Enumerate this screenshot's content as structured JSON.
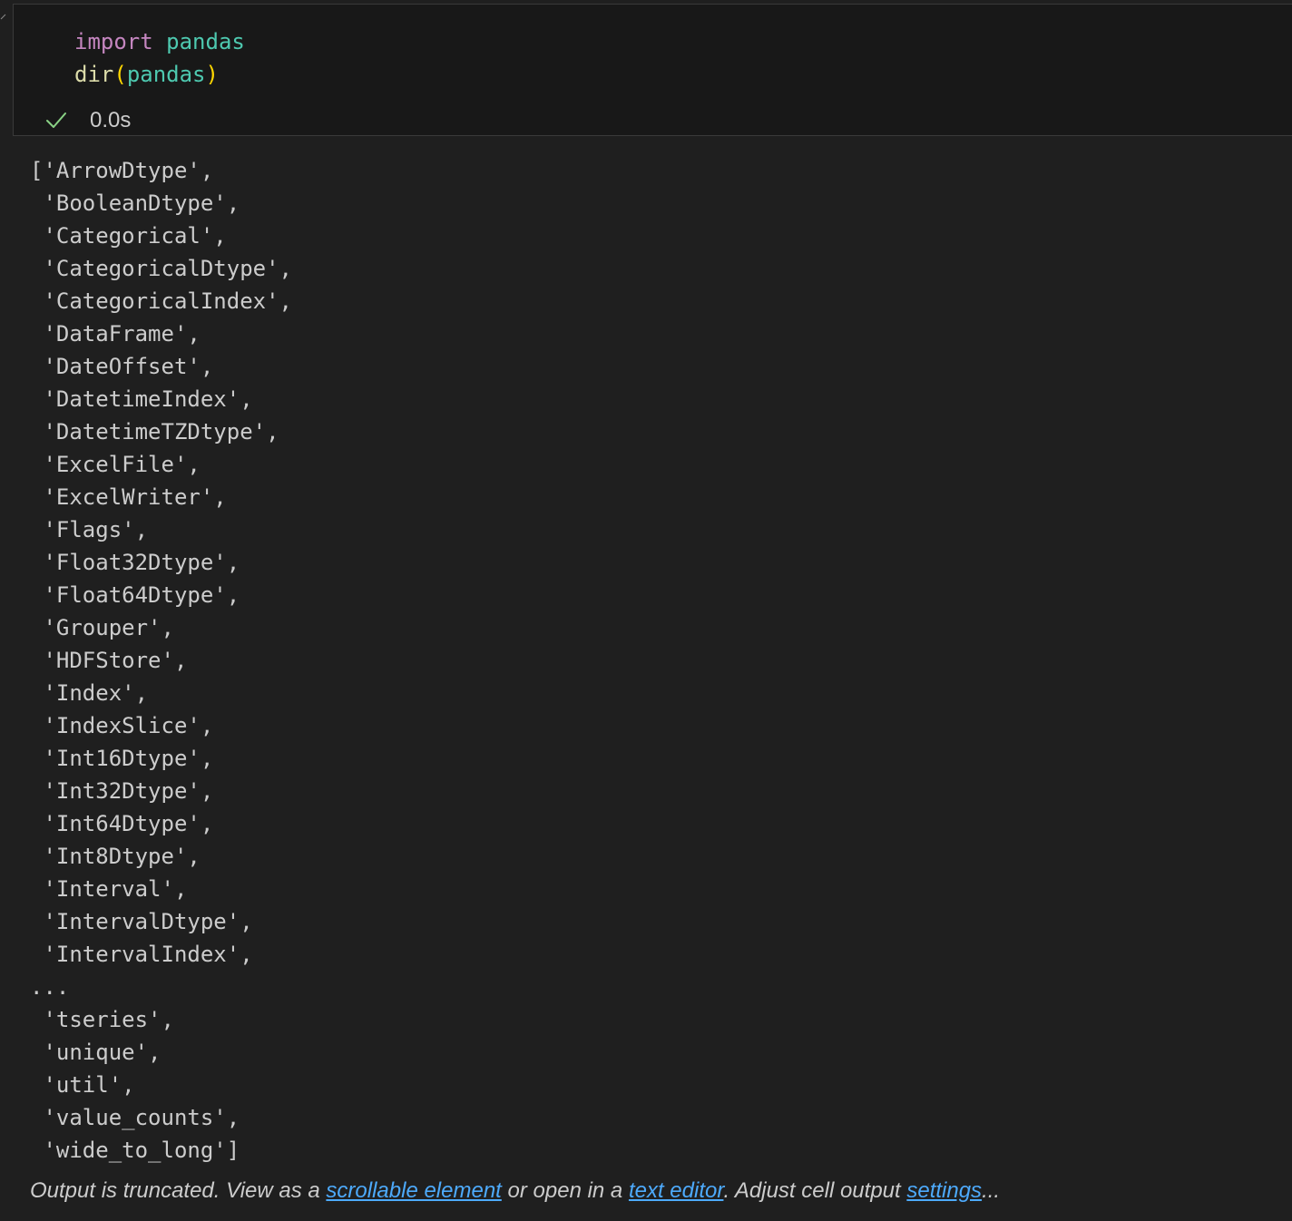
{
  "cell": {
    "code": {
      "line1": {
        "keyword": "import",
        "module": "pandas"
      },
      "line2": {
        "func": "dir",
        "open": "(",
        "arg": "pandas",
        "close": ")"
      }
    },
    "status": {
      "icon": "check-icon",
      "time": "0.0s",
      "color": "#89d185"
    }
  },
  "output": {
    "lines": [
      "['ArrowDtype',",
      " 'BooleanDtype',",
      " 'Categorical',",
      " 'CategoricalDtype',",
      " 'CategoricalIndex',",
      " 'DataFrame',",
      " 'DateOffset',",
      " 'DatetimeIndex',",
      " 'DatetimeTZDtype',",
      " 'ExcelFile',",
      " 'ExcelWriter',",
      " 'Flags',",
      " 'Float32Dtype',",
      " 'Float64Dtype',",
      " 'Grouper',",
      " 'HDFStore',",
      " 'Index',",
      " 'IndexSlice',",
      " 'Int16Dtype',",
      " 'Int32Dtype',",
      " 'Int64Dtype',",
      " 'Int8Dtype',",
      " 'Interval',",
      " 'IntervalDtype',",
      " 'IntervalIndex',",
      "...",
      " 'tseries',",
      " 'unique',",
      " 'util',",
      " 'value_counts',",
      " 'wide_to_long']"
    ],
    "truncation": {
      "prefix": "Output is truncated. View as a ",
      "link_scrollable": "scrollable element",
      "middle": " or open in a ",
      "link_text_editor": "text editor",
      "middle2": ". Adjust cell output ",
      "link_settings": "settings",
      "suffix": "..."
    }
  },
  "colors": {
    "background": "#1f1f1f",
    "editor_background": "#181818",
    "keyword": "#c586c0",
    "module": "#4ec9b0",
    "function": "#dcdcaa",
    "bracket": "#ffd700",
    "link": "#4daafc"
  }
}
